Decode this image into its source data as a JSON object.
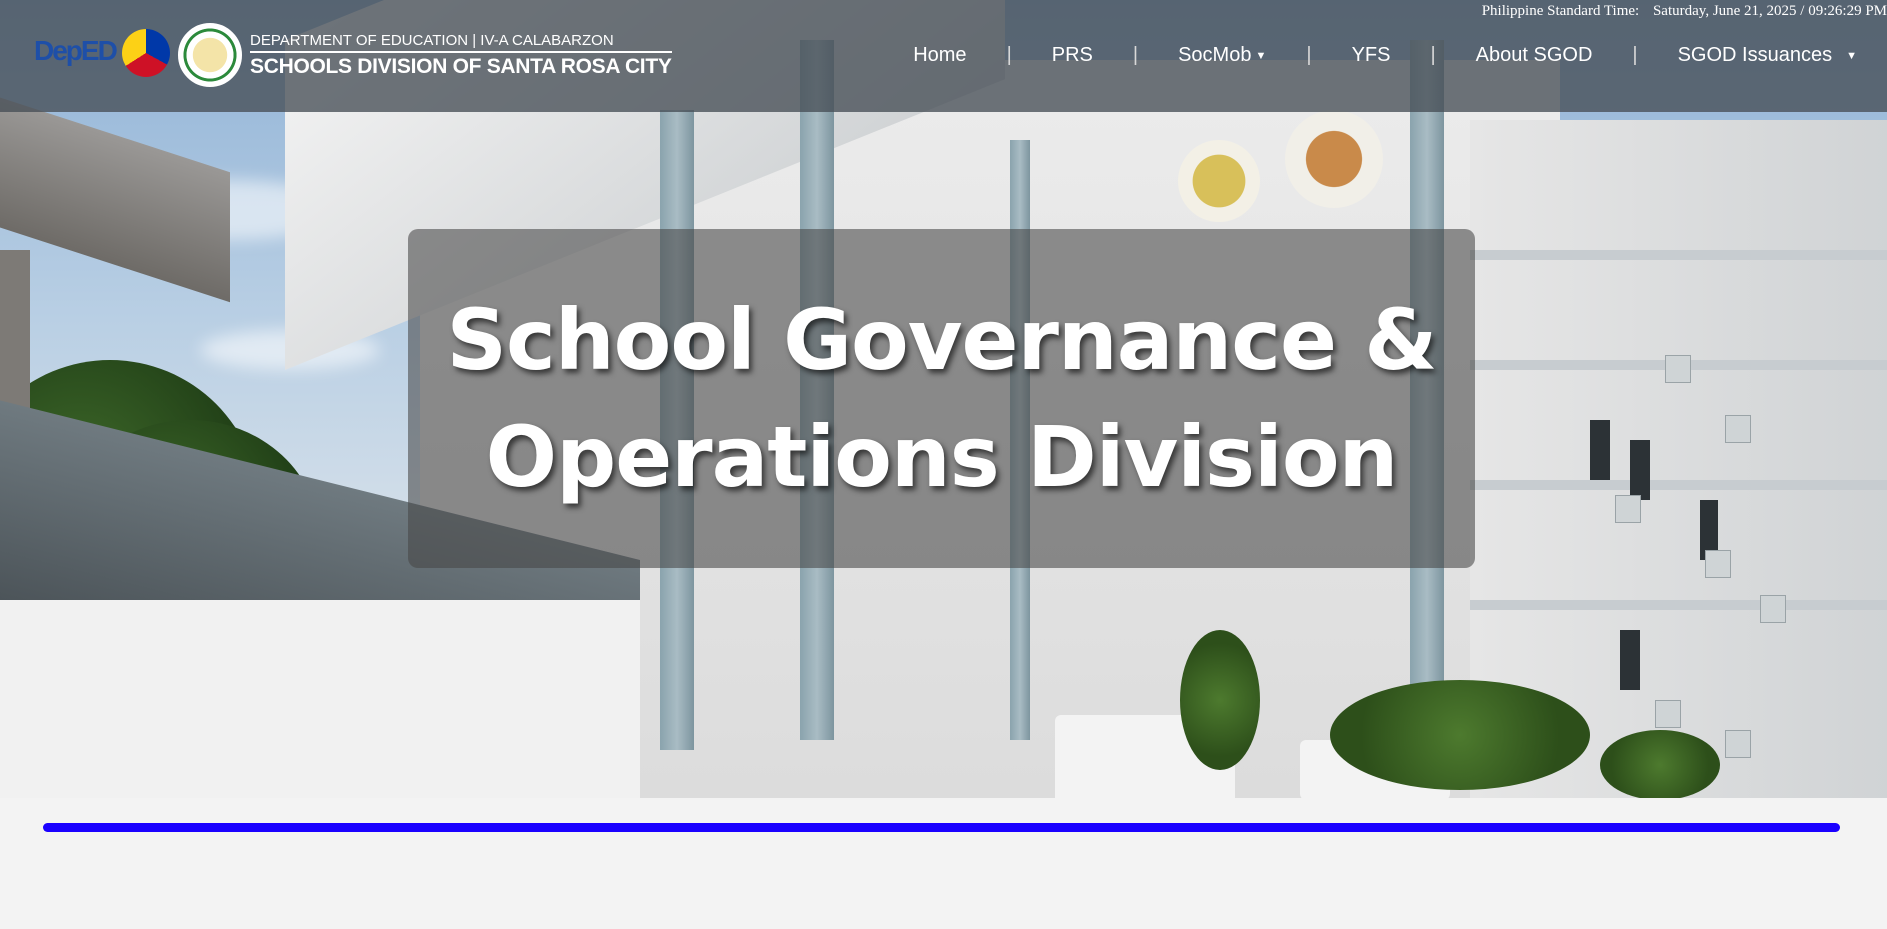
{
  "header": {
    "clock_label": "Philippine Standard Time:",
    "clock_value": "Saturday, June 21, 2025 / 09:26:29 PM",
    "logo_deped": "DepED",
    "brand_top": "DEPARTMENT OF EDUCATION | IV-A CALABARZON",
    "brand_bottom": "SCHOOLS DIVISION OF SANTA ROSA CITY"
  },
  "nav": {
    "items": [
      {
        "label": "Home",
        "icon": "",
        "has_dropdown": false
      },
      {
        "label": "PRS",
        "icon": "",
        "has_dropdown": false
      },
      {
        "label": "SocMob",
        "icon": "caret-down",
        "has_dropdown": true
      },
      {
        "label": "YFS",
        "icon": "",
        "has_dropdown": false
      },
      {
        "label": "About SGOD",
        "icon": "",
        "has_dropdown": false
      },
      {
        "label": "SGOD Issuances",
        "icon": "caret-down",
        "has_dropdown": true
      }
    ],
    "separator": "|",
    "caret": "▼"
  },
  "hero": {
    "title_line1": "School Governance &",
    "title_line2": "Operations Division"
  },
  "colors": {
    "header_bg": "#464e56",
    "divider": "#1a00ff",
    "page_bg": "#f3f3f3"
  }
}
